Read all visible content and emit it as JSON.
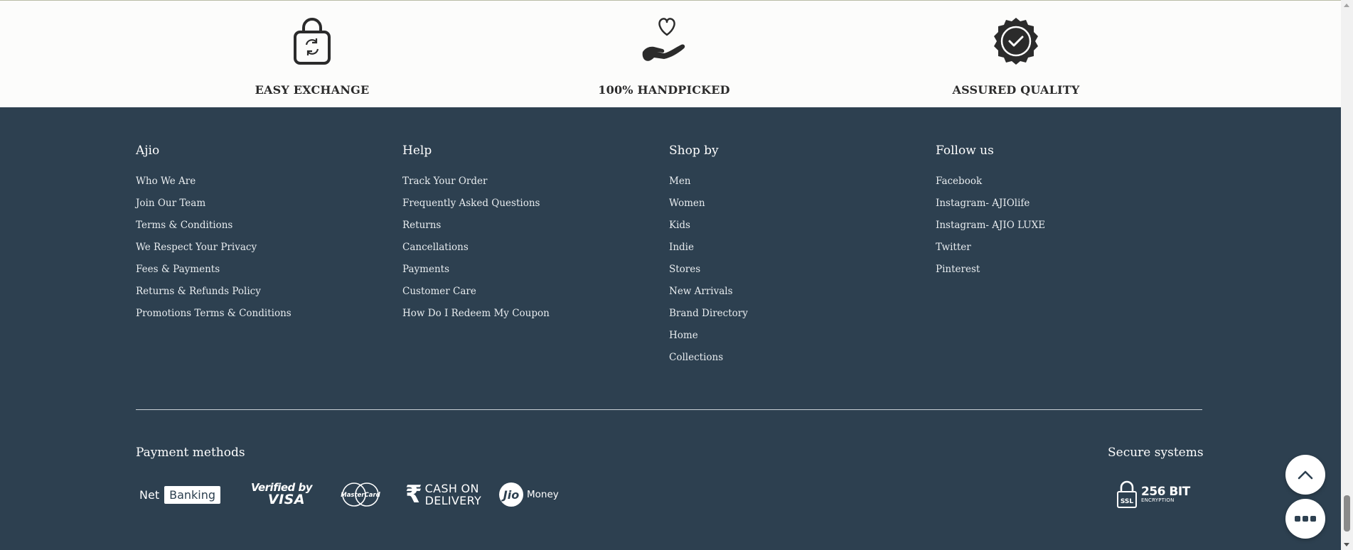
{
  "features": [
    {
      "label": "EASY EXCHANGE",
      "icon": "shopping-bag-exchange-icon"
    },
    {
      "label": "100% HANDPICKED",
      "icon": "hand-heart-icon"
    },
    {
      "label": "ASSURED QUALITY",
      "icon": "quality-badge-check-icon"
    }
  ],
  "footer": {
    "columns": [
      {
        "title": "Ajio",
        "links": [
          "Who We Are",
          "Join Our Team",
          "Terms & Conditions",
          "We Respect Your Privacy",
          "Fees & Payments",
          "Returns & Refunds Policy",
          "Promotions Terms & Conditions"
        ]
      },
      {
        "title": "Help",
        "links": [
          "Track Your Order",
          "Frequently Asked Questions",
          "Returns",
          "Cancellations",
          "Payments",
          "Customer Care",
          "How Do I Redeem My Coupon"
        ]
      },
      {
        "title": "Shop by",
        "links": [
          "Men",
          "Women",
          "Kids",
          "Indie",
          "Stores",
          "New Arrivals",
          "Brand Directory",
          "Home",
          "Collections"
        ]
      },
      {
        "title": "Follow us",
        "links": [
          "Facebook",
          "Instagram- AJIOlife",
          "Instagram- AJIO LUXE",
          "Twitter",
          "Pinterest"
        ]
      }
    ]
  },
  "payment": {
    "title": "Payment methods",
    "net_banking": {
      "net": "Net",
      "banking": "Banking"
    },
    "visa": {
      "line1": "Verified by",
      "line2": "VISA"
    },
    "mastercard": "MasterCard",
    "cod": {
      "symbol": "₹",
      "line1": "CASH ON",
      "line2": "DELIVERY"
    },
    "jio": {
      "badge": "Jio",
      "money": "Money"
    }
  },
  "secure": {
    "title": "Secure systems",
    "ssl": "SSL",
    "bits": "256 BIT",
    "encryption": "ENCRYPTION"
  },
  "colors": {
    "footer_bg": "#2d4050",
    "feature_band_bg": "#fcfcfb",
    "icon_dark": "#2b2b2b"
  }
}
